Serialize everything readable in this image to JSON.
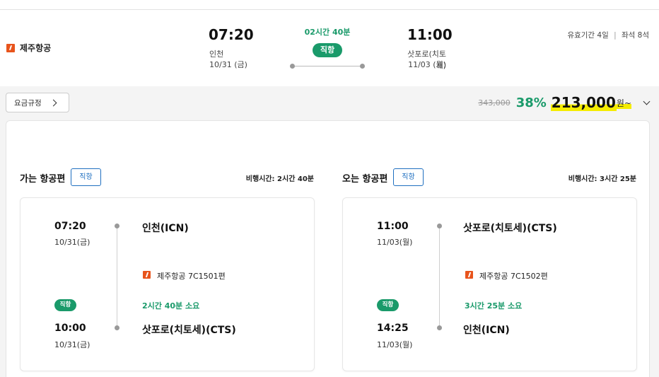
{
  "summary": {
    "airline": "제주항공",
    "departure": {
      "time": "07:20",
      "city": "인천",
      "date": "10/31 (금)"
    },
    "duration": "02시간 40분",
    "direct_label": "직항",
    "arrival": {
      "time": "11:00",
      "city": "삿포로(치토세)",
      "date": "11/03 (월)"
    },
    "validity": "유효기간 4일",
    "seats": "좌석 8석",
    "separator": "|"
  },
  "fare": {
    "rule_button": "요금규정",
    "original_price": "343,000",
    "discount": "38%",
    "final_price": "213,000",
    "currency": "원~"
  },
  "outbound": {
    "title": "가는 항공편",
    "badge": "직항",
    "flight_time": "비행시간: 2시간 40분",
    "dep_time": "07:20",
    "dep_date": "10/31(금)",
    "dep_city": "인천(ICN)",
    "airline_flight": "제주항공 7C1501편",
    "duration": "2시간 40분 소요",
    "direct_label": "직항",
    "arr_time": "10:00",
    "arr_date": "10/31(금)",
    "arr_city": "삿포로(치토세)(CTS)"
  },
  "inbound": {
    "title": "오는 항공편",
    "badge": "직항",
    "flight_time": "비행시간: 3시간 25분",
    "dep_time": "11:00",
    "dep_date": "11/03(월)",
    "dep_city": "삿포로(치토세)(CTS)",
    "airline_flight": "제주항공 7C1502편",
    "duration": "3시간 25분 소요",
    "direct_label": "직항",
    "arr_time": "14:25",
    "arr_date": "11/03(월)",
    "arr_city": "인천(ICN)"
  },
  "colors": {
    "accent_green": "#1a9a6a",
    "badge_blue": "#1f6fc0",
    "airline_orange": "#e8541c",
    "highlight_yellow": "#f5ec00"
  },
  "icons": {
    "airline_logo": "jeju-air-logo-icon",
    "rule_arrow": "chevron-right-icon",
    "expand": "chevron-down-icon"
  }
}
